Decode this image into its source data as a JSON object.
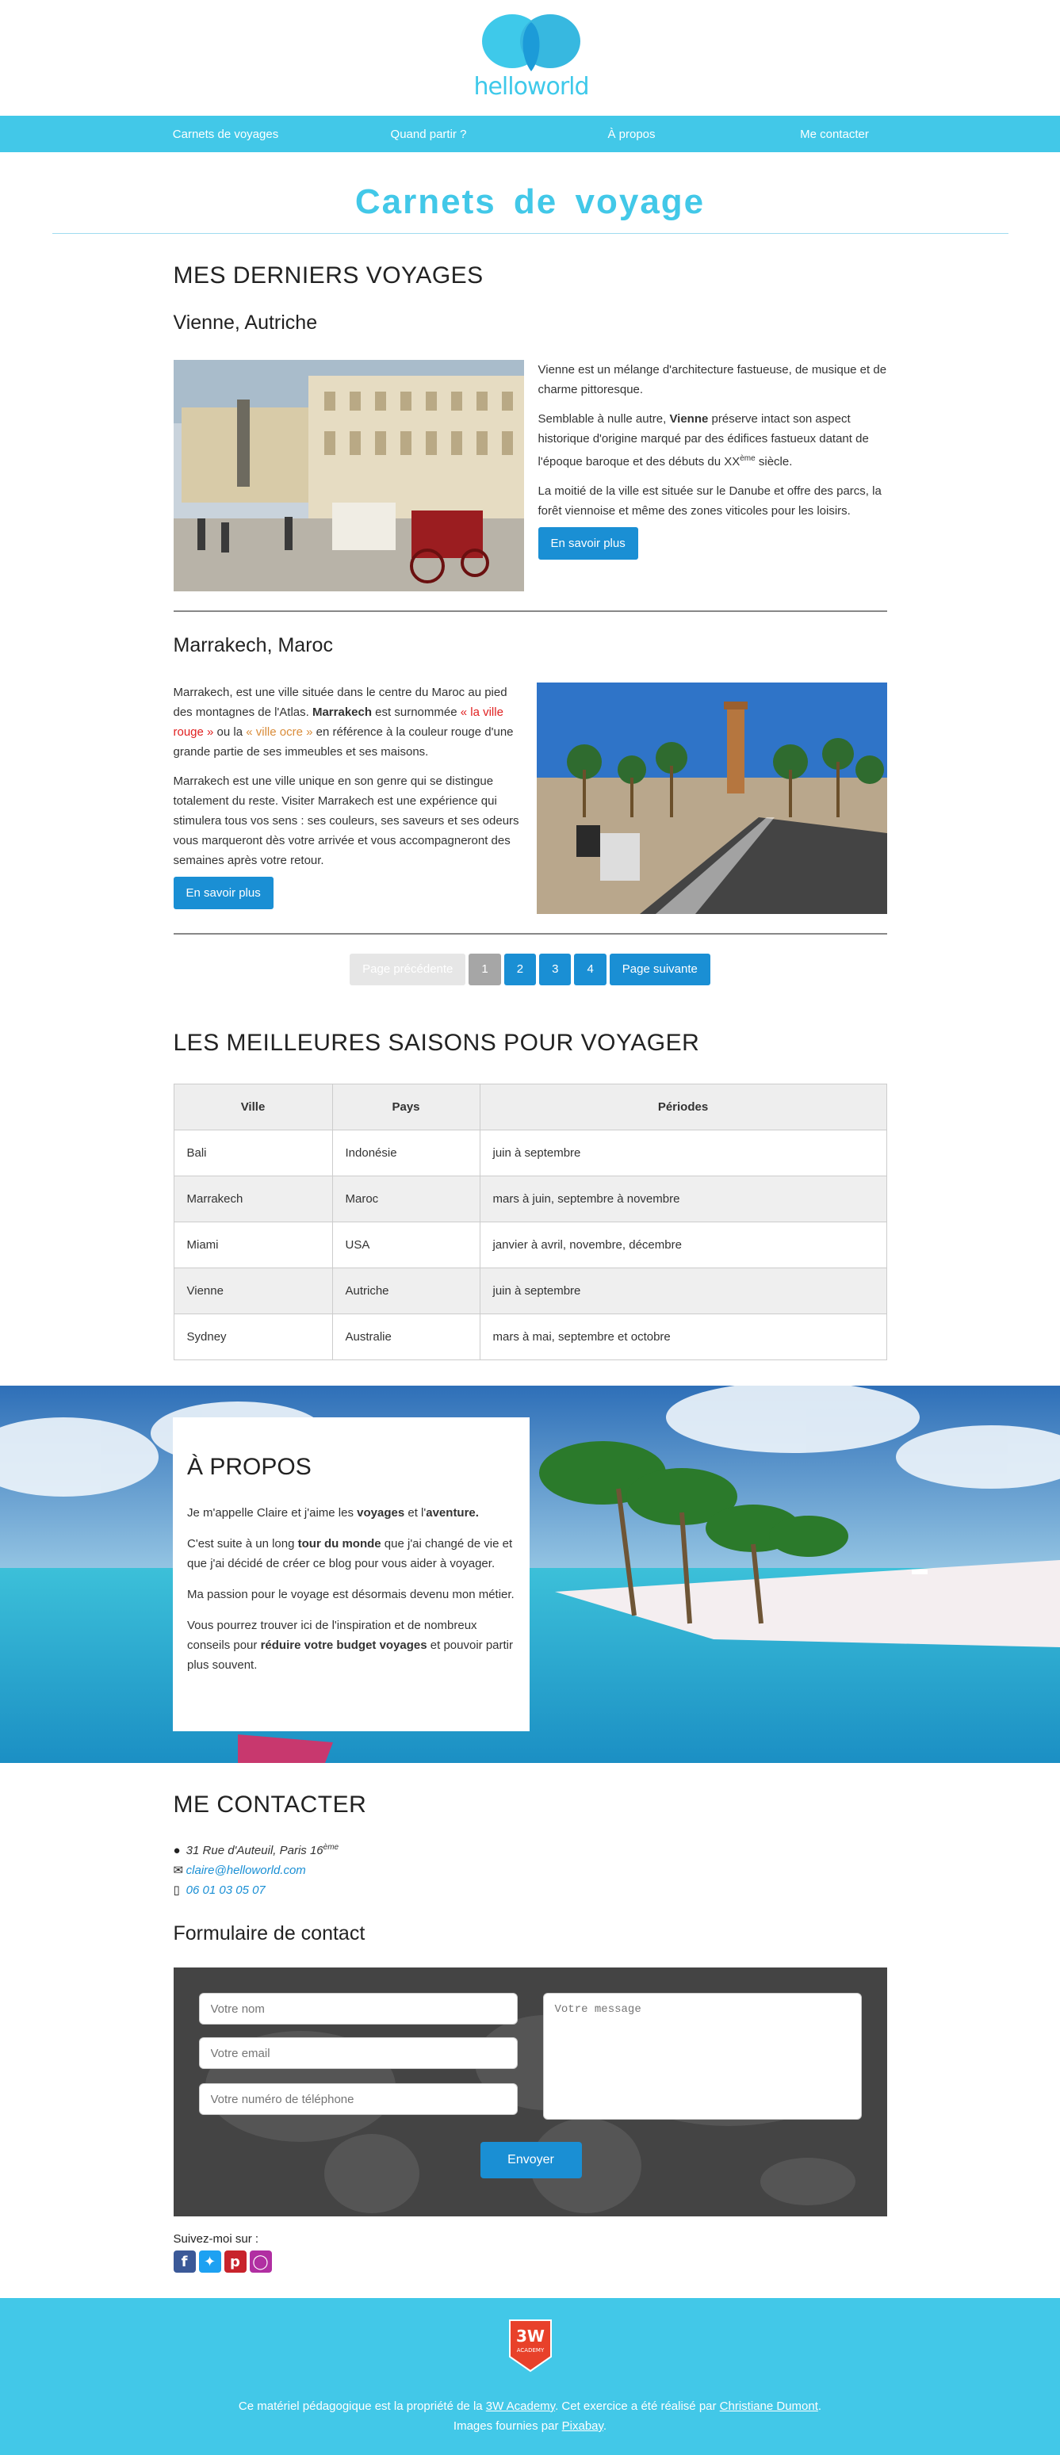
{
  "brand": {
    "logo_text": "helloworld"
  },
  "nav": [
    "Carnets de voyages",
    "Quand partir ?",
    "À propos",
    "Me contacter"
  ],
  "page_title": "Carnets de voyage",
  "latest": {
    "heading": "MES DERNIERS VOYAGES",
    "trips": [
      {
        "title": "Vienne, Autriche",
        "p1": "Vienne est un mélange d'architecture fastueuse, de musique et de charme pittoresque.",
        "p2_a": "Semblable à nulle autre, ",
        "p2_b": "Vienne",
        "p2_c": " préserve intact son aspect historique d'origine marqué par des édifices fastueux datant de l'époque baroque et des débuts du XX",
        "p2_sup": "ème",
        "p2_d": " siècle.",
        "p3": "La moitié de la ville est située sur le Danube et offre des parcs, la forêt viennoise et même des zones viticoles pour les loisirs.",
        "button": "En savoir plus"
      },
      {
        "title": "Marrakech, Maroc",
        "p1_a": "Marrakech, est une ville située dans le centre du Maroc au pied des montagnes de l'Atlas. ",
        "p1_b": "Marrakech",
        "p1_c": " est surnommée ",
        "p1_d": "« la ville rouge »",
        "p1_e": " ou la ",
        "p1_f": "« ville ocre »",
        "p1_g": " en référence à la couleur rouge d'une grande partie de ses immeubles et ses maisons.",
        "p2": "Marrakech est une ville unique en son genre qui se distingue totalement du reste. Visiter Marrakech est une expérience qui stimulera tous vos sens : ses couleurs, ses saveurs et ses odeurs vous marqueront dès votre arrivée et vous accompagneront des semaines après votre retour.",
        "button": "En savoir plus"
      }
    ]
  },
  "pager": {
    "prev": "Page précédente",
    "pages": [
      "1",
      "2",
      "3",
      "4"
    ],
    "next": "Page suivante"
  },
  "seasons": {
    "heading": "LES MEILLEURES SAISONS POUR VOYAGER",
    "columns": [
      "Ville",
      "Pays",
      "Périodes"
    ],
    "rows": [
      [
        "Bali",
        "Indonésie",
        "juin à septembre"
      ],
      [
        "Marrakech",
        "Maroc",
        "mars à juin, septembre à novembre"
      ],
      [
        "Miami",
        "USA",
        "janvier à avril, novembre, décembre"
      ],
      [
        "Vienne",
        "Autriche",
        "juin à septembre"
      ],
      [
        "Sydney",
        "Australie",
        "mars à mai, septembre et octobre"
      ]
    ]
  },
  "about": {
    "heading": "À PROPOS",
    "p1_a": "Je m'appelle Claire et j'aime les ",
    "p1_b": "voyages",
    "p1_c": " et l'",
    "p1_d": "aventure.",
    "p2_a": "C'est suite à un long ",
    "p2_b": "tour du monde",
    "p2_c": " que j'ai changé de vie et que j'ai décidé de créer ce blog pour vous aider à voyager.",
    "p3": "Ma passion pour le voyage est désormais devenu mon métier.",
    "p4_a": "Vous pourrez trouver ici de l'inspiration et de nombreux conseils pour ",
    "p4_b": "réduire votre budget voyages",
    "p4_c": " et pouvoir partir plus souvent."
  },
  "contact": {
    "heading": "ME CONTACTER",
    "address": "31 Rue d'Auteuil, Paris 16",
    "address_sup": "ème",
    "email": "claire@helloworld.com",
    "phone": "06 01 03 05 07",
    "form_title": "Formulaire de contact",
    "name_placeholder": "Votre nom",
    "email_placeholder": "Votre email",
    "phone_placeholder": "Votre numéro de téléphone",
    "message_placeholder": "Votre message",
    "send": "Envoyer",
    "follow": "Suivez-moi sur :",
    "socials": [
      "facebook-icon",
      "twitter-icon",
      "pinterest-icon",
      "instagram-icon"
    ]
  },
  "footer": {
    "badge_line1": "3W",
    "badge_line2": "ACADEMY",
    "l1_a": "Ce matériel pédagogique est la propriété de la ",
    "l1_link": "3W Academy",
    "l1_b": ". Cet exercice a été réalisé par ",
    "l1_author": "Christiane Dumont",
    "l1_c": ".",
    "l2_a": "Images fournies par ",
    "l2_link": "Pixabay",
    "l2_b": "."
  },
  "colors": {
    "accent": "#42c8e8",
    "button": "#1a8fd4",
    "footer": "#42c8e8"
  }
}
